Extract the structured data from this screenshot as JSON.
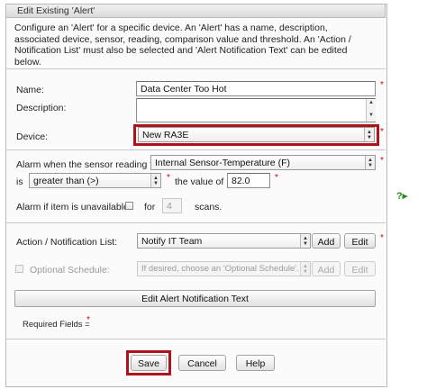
{
  "window": {
    "title": "Edit Existing 'Alert'"
  },
  "intro_text": "Configure an 'Alert' for a specific device. An 'Alert' has a name, description, associated device, sensor, reading, comparison value and threshold. An 'Action / Notification List' must also be selected and 'Alert Notification Text' can be edited below.",
  "required_mark": "*",
  "fields": {
    "name_label": "Name:",
    "name_value": "Data Center Too Hot",
    "description_label": "Description:",
    "description_value": "",
    "device_label": "Device:",
    "device_value": "New RA3E",
    "alarm_label": "Alarm when the sensor reading for",
    "sensor_value": "Internal Sensor-Temperature (F)",
    "is_label": "is",
    "comparison_value": "greater than (>)",
    "value_of_label": "the value of",
    "threshold_value": "82.0",
    "unavailable_label": "Alarm if item is unavailable:",
    "for_label": "for",
    "scans_value": "4",
    "scans_label": "scans."
  },
  "action": {
    "label": "Action / Notification List:",
    "value": "Notify IT Team",
    "add_label": "Add",
    "edit_label": "Edit"
  },
  "schedule": {
    "label": "Optional Schedule:",
    "placeholder": "If desired, choose an 'Optional Schedule'.",
    "add_label": "Add",
    "edit_label": "Edit"
  },
  "edit_text_button": "Edit Alert Notification Text",
  "required_fields_note": "Required Fields =",
  "footer": {
    "save": "Save",
    "cancel": "Cancel",
    "help": "Help"
  },
  "help_icon": "question-arrow-icon",
  "colors": {
    "highlight": "#b0121b",
    "required": "#d0021b",
    "help": "#2e8b1e"
  }
}
